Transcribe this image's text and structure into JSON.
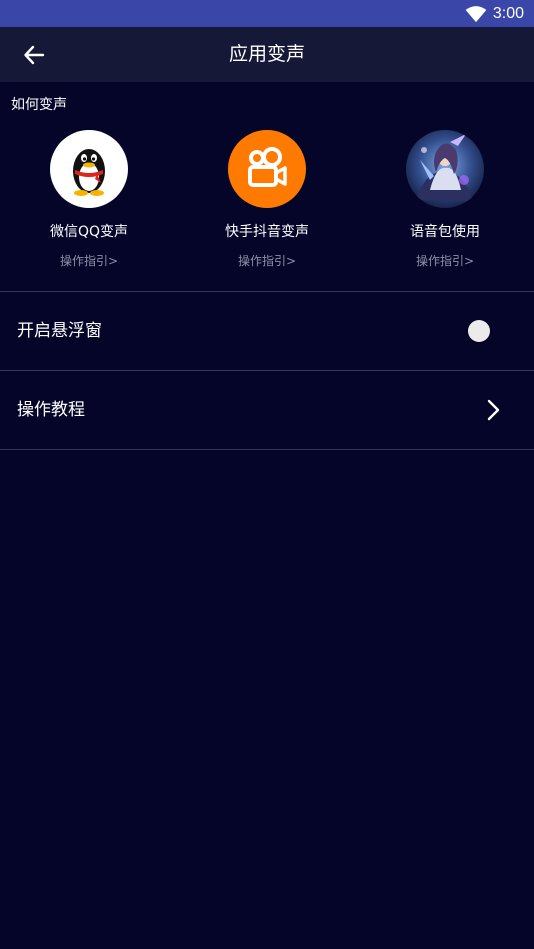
{
  "status_bar": {
    "time": "3:00",
    "wifi_icon": "wifi-icon"
  },
  "app_bar": {
    "title": "应用变声",
    "back_icon": "arrow-left-icon"
  },
  "section": {
    "title": "如何变声"
  },
  "shortcuts": [
    {
      "label": "微信QQ变声",
      "guide": "操作指引>",
      "icon": "qq-penguin-icon"
    },
    {
      "label": "快手抖音变声",
      "guide": "操作指引>",
      "icon": "kuaishou-icon"
    },
    {
      "label": "语音包使用",
      "guide": "操作指引>",
      "icon": "game-hero-avatar"
    }
  ],
  "settings": {
    "floating_window": {
      "label": "开启悬浮窗",
      "enabled": false
    },
    "tutorial": {
      "label": "操作教程",
      "icon": "chevron-right-icon"
    }
  },
  "colors": {
    "background": "#05052a",
    "status_bar": "#3a46a8",
    "app_bar": "#161838",
    "divider": "#34365a",
    "guide_text": "#8f90a6",
    "kuaishou_orange": "#ff7a00"
  }
}
